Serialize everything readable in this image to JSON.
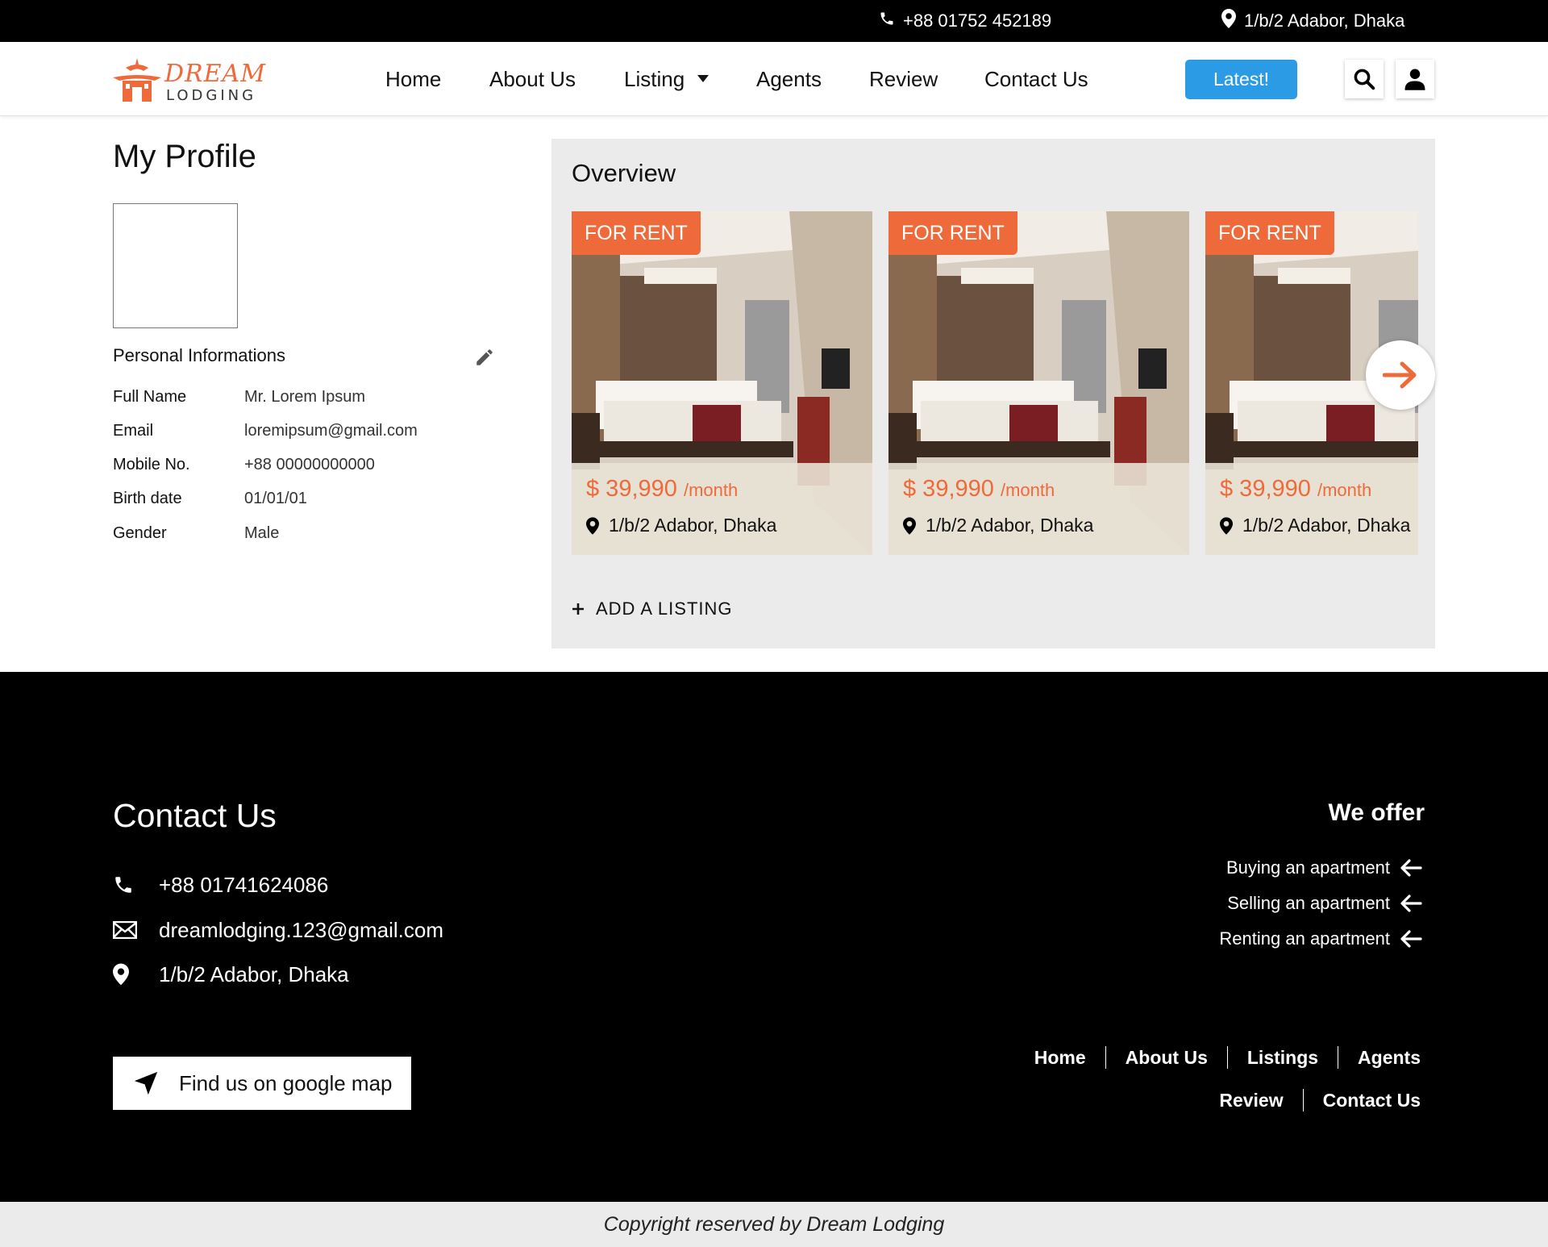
{
  "topbar": {
    "phone": "+88 01752 452189",
    "address": "1/b/2 Adabor, Dhaka"
  },
  "nav": {
    "logo_line1": "DREAM",
    "logo_line2": "LODGING",
    "items": [
      "Home",
      "About Us",
      "Listing",
      "Agents",
      "Review",
      "Contact Us"
    ],
    "latest_label": "Latest!",
    "icons": [
      "search-icon",
      "user-icon"
    ]
  },
  "profile": {
    "title": "My Profile",
    "section_title": "Personal Informations",
    "fields": [
      {
        "label": "Full Name",
        "value": "Mr. Lorem Ipsum"
      },
      {
        "label": "Email",
        "value": "loremipsum@gmail.com"
      },
      {
        "label": "Mobile No.",
        "value": "+88 00000000000"
      },
      {
        "label": "Birth date",
        "value": "01/01/01"
      },
      {
        "label": "Gender",
        "value": "Male"
      }
    ]
  },
  "overview": {
    "title": "Overview",
    "cards": [
      {
        "badge": "FOR RENT",
        "price": "$ 39,990",
        "unit": "/month",
        "address": "1/b/2 Adabor, Dhaka"
      },
      {
        "badge": "FOR RENT",
        "price": "$ 39,990",
        "unit": "/month",
        "address": "1/b/2 Adabor, Dhaka"
      },
      {
        "badge": "FOR RENT",
        "price": "$ 39,990",
        "unit": "/month",
        "address": "1/b/2 Adabor, Dhaka"
      }
    ],
    "add_listing": "ADD A LISTING"
  },
  "footer": {
    "contact_title": "Contact Us",
    "phone": "+88 01741624086",
    "email": "dreamlodging.123@gmail.com",
    "address": "1/b/2 Adabor, Dhaka",
    "map_button": "Find us on google map",
    "offer_title": "We offer",
    "offers": [
      "Buying an apartment",
      "Selling an apartment",
      "Renting an apartment"
    ],
    "links_row1": [
      "Home",
      "About Us",
      "Listings",
      "Agents"
    ],
    "links_row2": [
      "Review",
      "Contact Us"
    ]
  },
  "copyright": "Copyright reserved by Dream Lodging",
  "colors": {
    "accent": "#ef6a3a",
    "button_blue": "#2b9be6",
    "dark": "#000000",
    "panel": "#ebebeb"
  }
}
